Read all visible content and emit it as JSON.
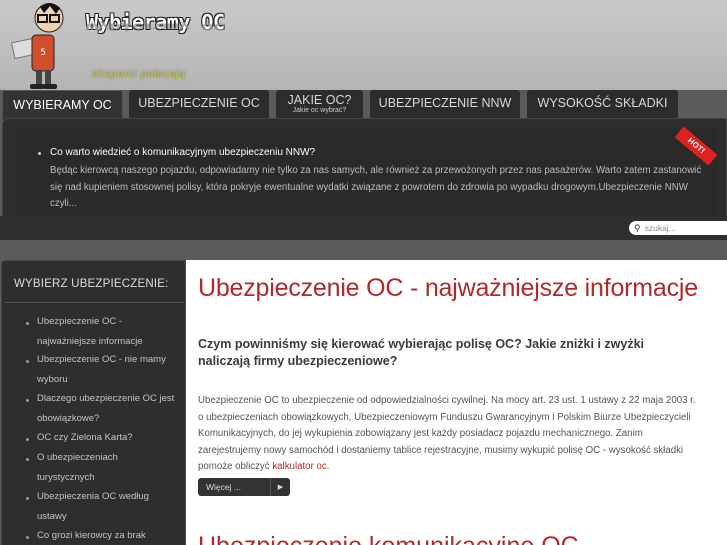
{
  "header": {
    "logo_title": "Wybieramy OC",
    "logo_reflection": "Wybieramy OC",
    "tagline": "eksperci polecają"
  },
  "nav": {
    "tabs": [
      {
        "label": "WYBIERAMY OC",
        "active": true
      },
      {
        "label": "UBEZPIECZENIE OC"
      },
      {
        "label": "JAKIE OC?",
        "sub": "Jakie oc wybrać?"
      },
      {
        "label": "UBEZPIECZENIE NNW"
      },
      {
        "label": "WYSOKOŚĆ SKŁADKI"
      }
    ]
  },
  "featured": {
    "badge": "HOT!",
    "title": "Co warto wiedzieć o komunikacyjnym ubezpieczeniu NNW?",
    "body": "Będąc kierowcą naszego pojazdu, odpowiadamy nie tylko za nas samych, ale również za przewożonych przez nas pasażerów. Warto zatem zastanowić się nad kupieniem stosownej polisy, która pokryje ewentualne wydatki związane z powrotem do zdrowia po wypadku drogowym.Ubezpieczenie NNW czyli..."
  },
  "search": {
    "placeholder": "szukaj..."
  },
  "sidebar": {
    "title": "WYBIERZ UBEZPIECZENIE:",
    "items": [
      {
        "label": "Ubezpieczenie OC - najważniejsze informacje"
      },
      {
        "label": "Ubezpieczenie OC - nie mamy wyboru"
      },
      {
        "label": "Dlaczego ubezpieczenie OC jest obowiązkowe?"
      },
      {
        "label": "OC czy Zielona Karta?"
      },
      {
        "label": "O ubezpieczeniach turystycznych"
      },
      {
        "label": "Ubezpieczenia OC według ustawy"
      },
      {
        "label": "Co grozi kierowcy za brak"
      }
    ]
  },
  "main": {
    "article_title": "Ubezpieczenie OC - najważniejsze informacje",
    "article_subtitle": "Czym powinniśmy się kierować wybierając polisę OC? Jakie zniżki i zwyżki naliczają firmy ubezpieczeniowe?",
    "article_body": "Ubezpieczenie OC to ubezpieczenie od odpowiedzialności cywilnej. Na mocy art. 23 ust. 1 ustawy z 22 maja 2003 r. o ubezpieczeniach obowiązkowych, Ubezpieczeniowym Funduszu Gwarancyjnym i Polskim Biurze Ubezpieczycieli Komunikacyjnych, do jej wykupienia zobowiązany jest każdy posiadacz pojazdu mechanicznego. Zanim zarejestrujemy nowy samochód i dostaniemy tablice rejestracyjne, musimy wykupić polisę OC - wysokość składki pomoże obliczyć",
    "article_link": "kalkulator oc",
    "article_link_suffix": ".",
    "more_button": "Więcej ...",
    "next_article_title": "Ubezpieczenie komunikacyjne OC"
  }
}
